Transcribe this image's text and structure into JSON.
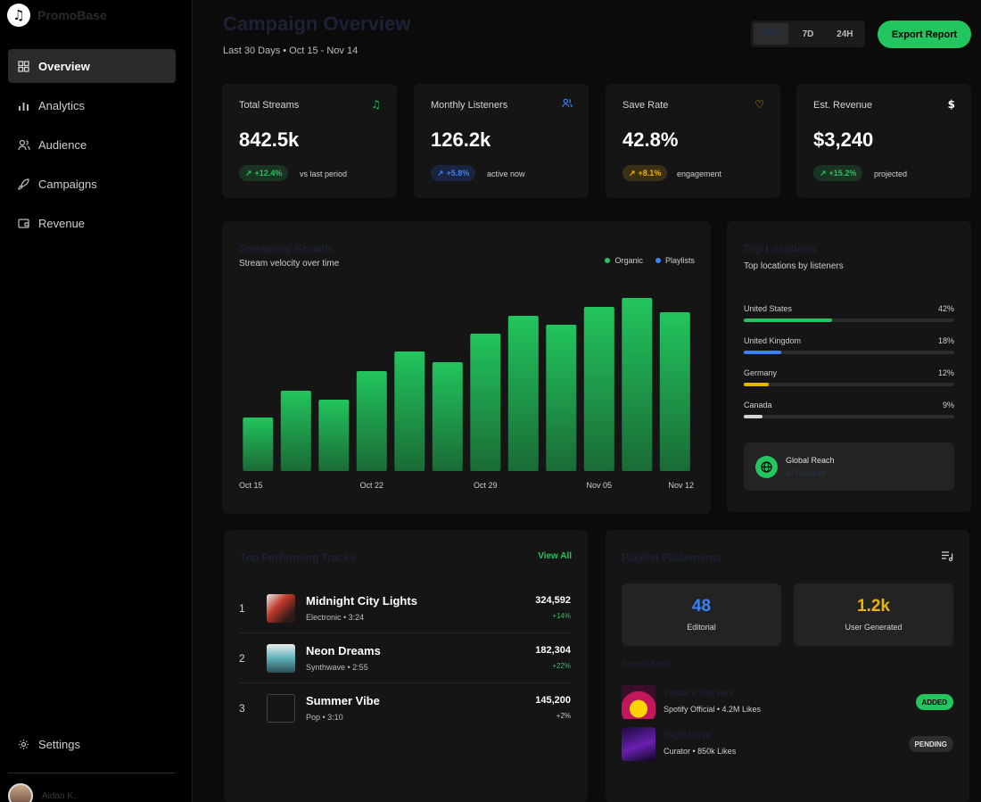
{
  "app": {
    "name": "PromoBase",
    "logo_icon": "music-note-icon"
  },
  "sidebar": {
    "items": [
      {
        "label": "Overview",
        "icon": "grid-icon",
        "active": true
      },
      {
        "label": "Analytics",
        "icon": "bar-chart-icon",
        "active": false
      },
      {
        "label": "Audience",
        "icon": "users-icon",
        "active": false
      },
      {
        "label": "Campaigns",
        "icon": "rocket-icon",
        "active": false
      },
      {
        "label": "Revenue",
        "icon": "wallet-icon",
        "active": false
      }
    ],
    "settings_label": "Settings",
    "user_name": "Aidan K."
  },
  "header": {
    "title": "Campaign Overview",
    "subtitle": "Last 30 Days • Oct 15 - Nov 14",
    "ranges": [
      "30D",
      "7D",
      "24H"
    ],
    "active_range": "30D",
    "export_label": "Export Report"
  },
  "stats": [
    {
      "label": "Total Streams",
      "value": "842.5k",
      "badge": "+12.4%",
      "note": "vs last period",
      "icon": "music-note-icon",
      "color": "#22c55e"
    },
    {
      "label": "Monthly Listeners",
      "value": "126.2k",
      "badge": "+5.8%",
      "note": "active now",
      "icon": "users-icon",
      "color": "#3b82f6"
    },
    {
      "label": "Save Rate",
      "value": "42.8%",
      "badge": "+8.1%",
      "note": "engagement",
      "icon": "heart-icon",
      "color": "#eab308"
    },
    {
      "label": "Est. Revenue",
      "value": "$3,240",
      "badge": "+15.2%",
      "note": "projected",
      "icon": "dollar-icon",
      "color": "#22c55e"
    }
  ],
  "growth": {
    "title": "Streaming Growth",
    "subtitle": "Stream velocity over time",
    "legend": [
      {
        "name": "Organic",
        "color": "#22c55e"
      },
      {
        "name": "Playlists",
        "color": "#3b82f6"
      }
    ]
  },
  "chart_data": {
    "type": "bar",
    "categories": [
      "Oct 15",
      "",
      "",
      "Oct 22",
      "",
      "",
      "Oct 29",
      "",
      "",
      "Nov 05",
      "",
      "Nov 12"
    ],
    "values": [
      30,
      45,
      40,
      56,
      67,
      61,
      77,
      87,
      82,
      92,
      97,
      89
    ],
    "ylim": [
      0,
      100
    ],
    "tick_labels": [
      "Oct 15",
      "Oct 22",
      "Oct 29",
      "Nov 05",
      "Nov 12"
    ],
    "grid": false,
    "bar_color": "#22c55e"
  },
  "geo": {
    "title": "Top Locations",
    "subtitle": "Top locations by listeners",
    "items": [
      {
        "name": "United States",
        "pct": "42%",
        "value": 42,
        "color": "#22c55e"
      },
      {
        "name": "United Kingdom",
        "pct": "18%",
        "value": 18,
        "color": "#3b82f6"
      },
      {
        "name": "Germany",
        "pct": "12%",
        "value": 12,
        "color": "#eab308"
      },
      {
        "name": "Canada",
        "pct": "9%",
        "value": 9,
        "color": "#d4d4d4"
      }
    ],
    "reach": {
      "title": "Global Reach",
      "subtitle": "42 Countries",
      "icon": "globe-icon"
    }
  },
  "tracks": {
    "title": "Top Performing Tracks",
    "view_all": "View All",
    "items": [
      {
        "rank": "1",
        "title": "Midnight City Lights",
        "meta": "Electronic • 3:24",
        "streams": "324,592",
        "change": "+14%",
        "change_color": "#22c55e"
      },
      {
        "rank": "2",
        "title": "Neon Dreams",
        "meta": "Synthwave • 2:55",
        "streams": "182,304",
        "change": "+22%",
        "change_color": "#22c55e"
      },
      {
        "rank": "3",
        "title": "Summer Vibe",
        "meta": "Pop • 3:10",
        "streams": "145,200",
        "change": "+2%",
        "change_color": "#cfcfcf"
      }
    ]
  },
  "playlists": {
    "title": "Playlist Placements",
    "icon": "playlist-icon",
    "stats": [
      {
        "value": "48",
        "label": "Editorial",
        "color": "#3b82f6"
      },
      {
        "value": "1.2k",
        "label": "User Generated",
        "color": "#eab308"
      }
    ],
    "section_label": "Recent Adds",
    "items": [
      {
        "name": "Today's Top Hits",
        "meta": "Spotify Official • 4.2M Likes",
        "status": "ADDED"
      },
      {
        "name": "Night Drive",
        "meta": "Curator • 850k Likes",
        "status": "PENDING"
      }
    ]
  }
}
